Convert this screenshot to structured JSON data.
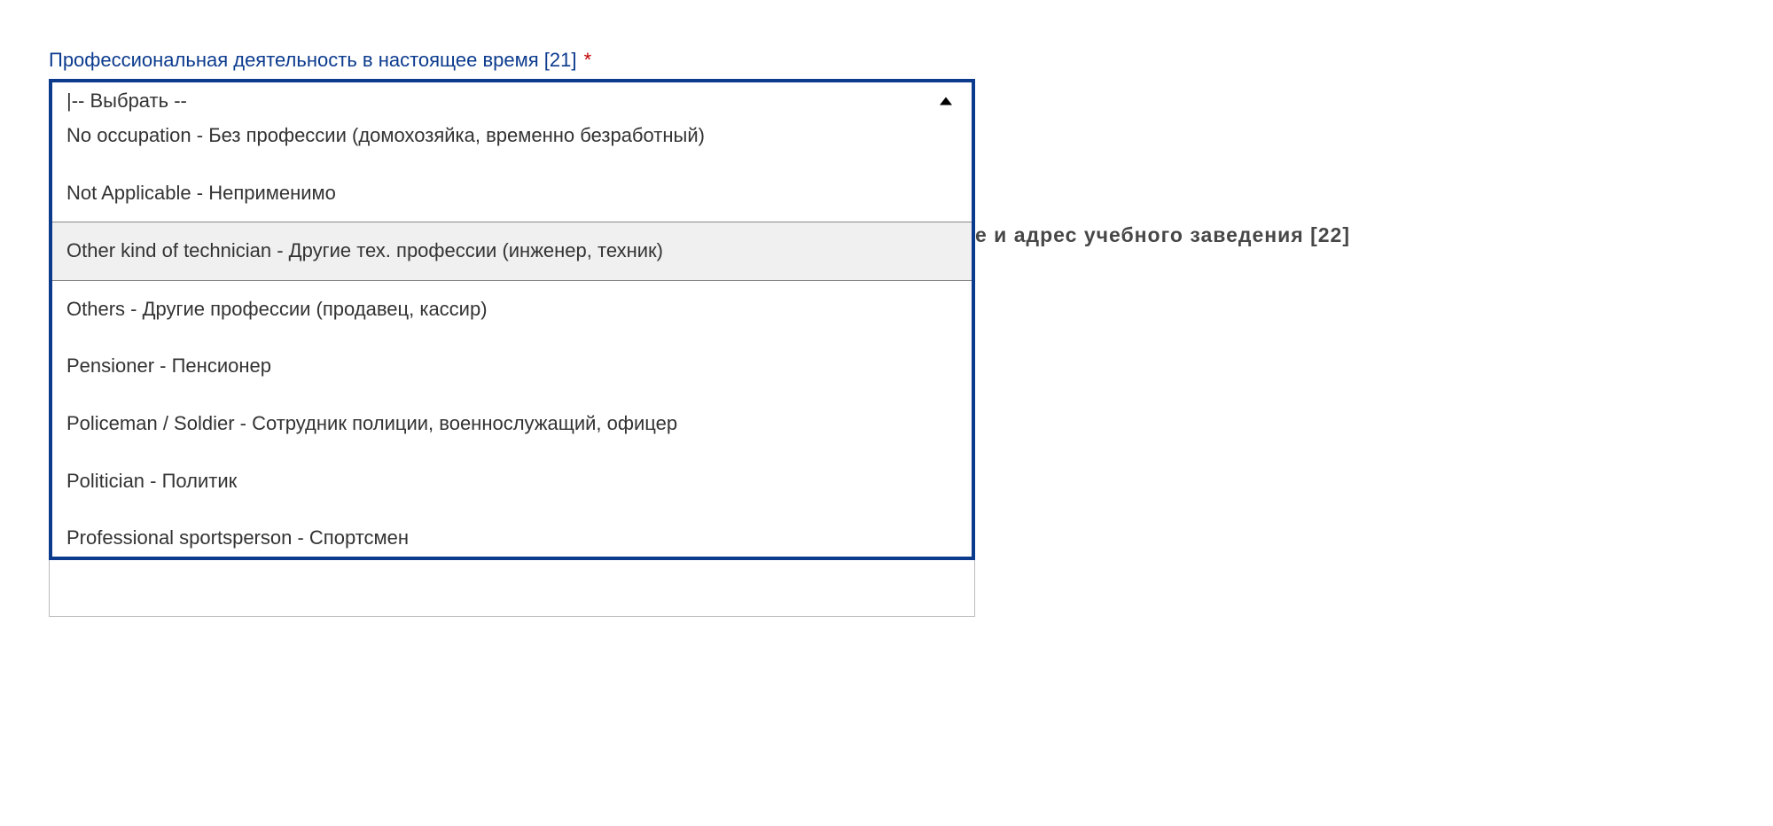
{
  "form": {
    "field21": {
      "label": "Профессиональная деятельность в настоящее время [21]",
      "required_marker": "*",
      "selected_value": "-- Выбрать --",
      "options": [
        {
          "label": "No occupation - Без профессии (домохозяйка, временно безработный)",
          "highlighted": false
        },
        {
          "label": "Not Applicable - Неприменимо",
          "highlighted": false
        },
        {
          "label": "Other kind of technician - Другие тех. профессии (инженер, техник)",
          "highlighted": true
        },
        {
          "label": "Others - Другие профессии (продавец, кассир)",
          "highlighted": false
        },
        {
          "label": "Pensioner - Пенсионер",
          "highlighted": false
        },
        {
          "label": "Policeman / Soldier - Сотрудник полиции, военнослужащий, офицер",
          "highlighted": false
        },
        {
          "label": "Politician - Политик",
          "highlighted": false
        },
        {
          "label": "Professional sportsperson - Спортсмен",
          "highlighted": false
        }
      ]
    },
    "field22": {
      "visible_fragment": "е и адрес учебного заведения [22]"
    }
  },
  "search_cursor": "|"
}
